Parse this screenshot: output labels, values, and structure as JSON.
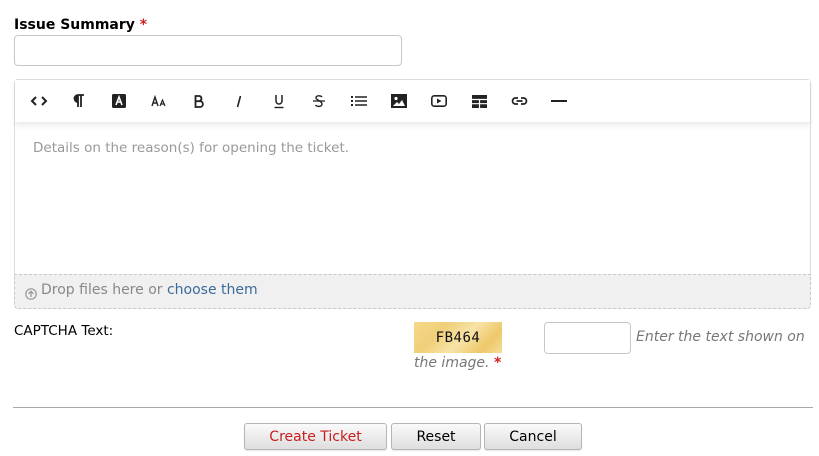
{
  "form": {
    "issue_summary_label": "Issue Summary",
    "required_mark": "*"
  },
  "editor": {
    "placeholder": "Details on the reason(s) for opening the ticket.",
    "toolbar": [
      {
        "name": "code-view",
        "glyph": "<>"
      },
      {
        "name": "paragraph",
        "glyph": "¶"
      },
      {
        "name": "text-color",
        "glyph": "A"
      },
      {
        "name": "font-size",
        "glyph": "Aa"
      },
      {
        "name": "bold",
        "glyph": "B"
      },
      {
        "name": "italic",
        "glyph": "I"
      },
      {
        "name": "underline",
        "glyph": "U"
      },
      {
        "name": "strikethrough",
        "glyph": "S"
      },
      {
        "name": "unordered-list",
        "glyph": "list"
      },
      {
        "name": "image",
        "glyph": "image"
      },
      {
        "name": "video",
        "glyph": "video"
      },
      {
        "name": "table",
        "glyph": "table"
      },
      {
        "name": "link",
        "glyph": "link"
      },
      {
        "name": "horizontal-rule",
        "glyph": "hr"
      }
    ]
  },
  "dropzone": {
    "text": "Drop files here or",
    "link": "choose them"
  },
  "captcha": {
    "label": "CAPTCHA Text:",
    "code": "FB464",
    "hint_line1": "Enter the text shown on",
    "hint_line2": "the image.",
    "required_mark": "*"
  },
  "buttons": {
    "create": "Create Ticket",
    "reset": "Reset",
    "cancel": "Cancel"
  },
  "colors": {
    "required": "#d21f1f",
    "link": "#3c6a9a",
    "create_button_text": "#c81e1e"
  }
}
